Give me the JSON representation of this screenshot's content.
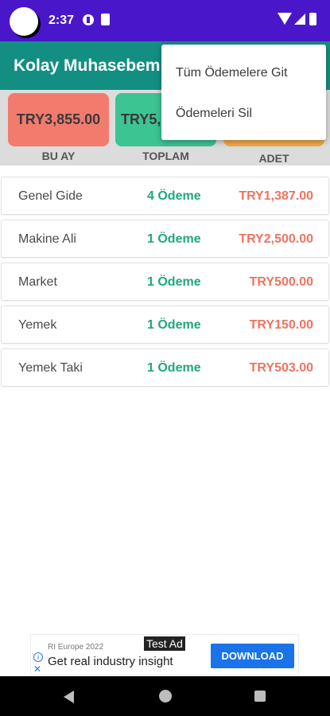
{
  "status_bar": {
    "time": "2:37"
  },
  "app_bar": {
    "title": "Kolay Muhasebem"
  },
  "summary": {
    "cards": [
      {
        "value": "TRY3,855.00",
        "caption": "BU AY",
        "color": "#f37b6e"
      },
      {
        "value": "TRY5,",
        "caption": "TOPLAM",
        "color": "#3cc493"
      },
      {
        "value": "",
        "caption": "ADET",
        "color": "#f3ab49"
      }
    ]
  },
  "list": {
    "rows": [
      {
        "name": "Genel Gide",
        "count": "4 Ödeme",
        "amount": "TRY1,387.00"
      },
      {
        "name": "Makine Ali",
        "count": "1 Ödeme",
        "amount": "TRY2,500.00"
      },
      {
        "name": "Market",
        "count": "1 Ödeme",
        "amount": "TRY500.00"
      },
      {
        "name": "Yemek",
        "count": "1 Ödeme",
        "amount": "TRY150.00"
      },
      {
        "name": "Yemek Taki",
        "count": "1 Ödeme",
        "amount": "TRY503.00"
      }
    ]
  },
  "menu": {
    "items": [
      "Tüm Ödemelere Git",
      "Ödemeleri Sil"
    ]
  },
  "ad": {
    "badge": "Test Ad",
    "sponsor": "RI Europe 2022",
    "headline": "Get real industry insight",
    "cta": "DOWNLOAD"
  },
  "colors": {
    "status_bar": "#4a16c9",
    "app_bar": "#138f82",
    "count_text": "#1fa87a",
    "amount_text": "#f0735f",
    "ad_button": "#1a73e8"
  },
  "icons": {
    "status": [
      "avatar",
      "data-saver-icon",
      "sd-card-icon",
      "wifi-icon",
      "signal-icon",
      "battery-icon"
    ],
    "navigation": [
      "back-icon",
      "home-icon",
      "recents-icon"
    ],
    "ad": [
      "ad-info-icon",
      "ad-close-icon"
    ]
  }
}
